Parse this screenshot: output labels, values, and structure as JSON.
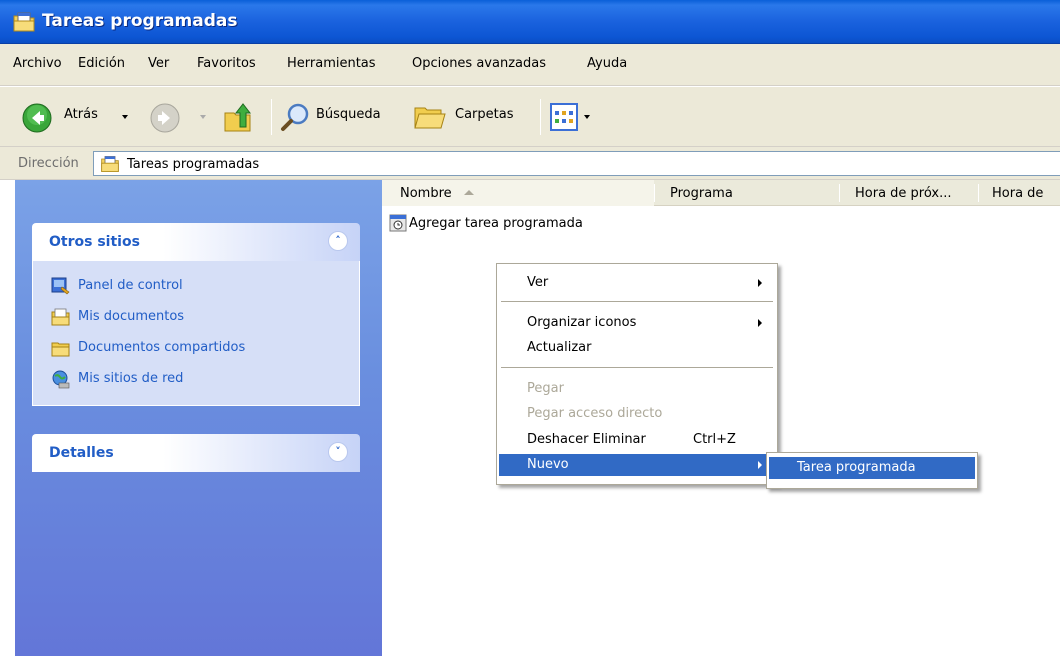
{
  "window": {
    "title": "Tareas programadas"
  },
  "menubar": {
    "items": [
      "Archivo",
      "Edición",
      "Ver",
      "Favoritos",
      "Herramientas",
      "Opciones avanzadas",
      "Ayuda"
    ]
  },
  "toolbar": {
    "back_label": "Atrás",
    "search_label": "Búsqueda",
    "folders_label": "Carpetas"
  },
  "address": {
    "label": "Dirección",
    "value": "Tareas programadas"
  },
  "taskpane": {
    "other_places": {
      "title": "Otros sitios",
      "links": [
        {
          "label": "Panel de control",
          "icon": "control-panel-icon"
        },
        {
          "label": "Mis documentos",
          "icon": "my-documents-icon"
        },
        {
          "label": "Documentos compartidos",
          "icon": "shared-folder-icon"
        },
        {
          "label": "Mis sitios de red",
          "icon": "network-places-icon"
        }
      ]
    },
    "details": {
      "title": "Detalles"
    }
  },
  "columns": [
    "Nombre",
    "Programa",
    "Hora de próx...",
    "Hora de"
  ],
  "files": [
    {
      "label": "Agregar tarea programada",
      "icon": "add-task-icon"
    }
  ],
  "context_menu": {
    "items": [
      {
        "label": "Ver",
        "submenu": true,
        "disabled": false
      },
      {
        "label": "Organizar iconos",
        "submenu": true,
        "disabled": false
      },
      {
        "label": "Actualizar",
        "submenu": false,
        "disabled": false
      },
      {
        "label": "Pegar",
        "submenu": false,
        "disabled": true
      },
      {
        "label": "Pegar acceso directo",
        "submenu": false,
        "disabled": true
      },
      {
        "label": "Deshacer Eliminar",
        "shortcut": "Ctrl+Z",
        "submenu": false,
        "disabled": false
      },
      {
        "label": "Nuevo",
        "submenu": true,
        "disabled": false,
        "highlighted": true
      }
    ],
    "submenu_items": [
      {
        "label": "Tarea programada",
        "highlighted": true
      }
    ]
  },
  "colors": {
    "title_bar": "#0a5fd8",
    "highlight": "#316ac5",
    "task_pane": "#6a8fdf",
    "link": "#215dc6"
  }
}
